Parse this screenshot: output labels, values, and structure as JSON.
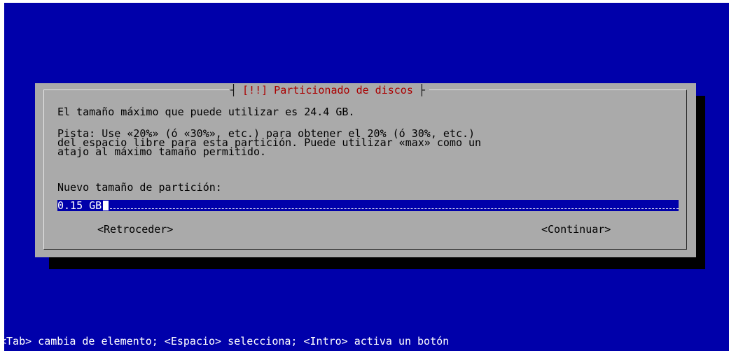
{
  "dialog": {
    "title": "[!!] Particionado de discos",
    "line_max_size": "El tamaño máximo que puede utilizar es 24.4 GB.",
    "hint": "Pista: Use «20%» (ó «30%», etc.) para obtener el 20% (ó 30%, etc.)\ndel espacio libre para esta partición. Puede utilizar «max» como un\natajo al máximo tamaño permitido.",
    "field_label": "Nuevo tamaño de partición:",
    "field_value": "0.15 GB",
    "back_button": "<Retroceder>",
    "continue_button": "<Continuar>"
  },
  "status_bar": {
    "help_text": "<Tab> cambia de elemento; <Espacio> selecciona; <Intro> activa un botón"
  },
  "colors": {
    "screen_bg": "#0000aa",
    "dialog_bg": "#aaaaaa",
    "title_color": "#aa0000",
    "input_bg": "#0000aa",
    "text_color": "#000000",
    "status_text": "#ffffff"
  }
}
